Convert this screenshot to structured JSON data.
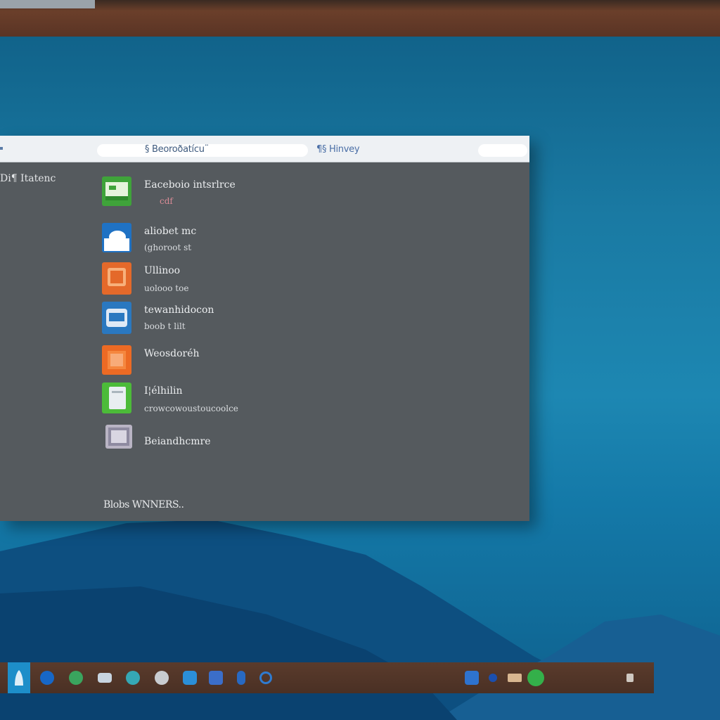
{
  "window": {
    "titlebar_left_text": "§ Beoroðatícu¨",
    "titlebar_right_text": "¶§ Hinvey",
    "sidebar_title": "Di¶ Itatenc",
    "footer_text": "Blobs WNNERS.."
  },
  "apps": [
    {
      "name": "Eaceboio intsrlrce",
      "sub": "cdf",
      "icon": "spreadsheet-icon",
      "color": "#3fa33a"
    },
    {
      "name": "aliobet mc",
      "sub": "(ghoroot st",
      "icon": "cloud-icon",
      "color": "#1f72c4"
    },
    {
      "name": "Ullinoo",
      "sub": "uolooo toe",
      "icon": "folder-icon",
      "color": "#e4692a"
    },
    {
      "name": "tewanhidocon",
      "sub": "boob t lilt",
      "icon": "message-icon",
      "color": "#2a78c0"
    },
    {
      "name": "Weosdoréh",
      "sub": "",
      "icon": "box-icon",
      "color": "#ec6a24"
    },
    {
      "name": "I¦élhilin",
      "sub": "crowcowoustoucoolce",
      "icon": "document-icon",
      "color": "#4cbb39"
    },
    {
      "name": "Beiandhcmre",
      "sub": "",
      "icon": "archive-icon",
      "color": "#b9b4c4"
    }
  ],
  "taskbar": {
    "items": [
      {
        "name": "start-icon",
        "color": "#dfeef7"
      },
      {
        "name": "browser-icon",
        "color": "#1767c7"
      },
      {
        "name": "maps-icon",
        "color": "#3aa55e"
      },
      {
        "name": "mail-icon",
        "color": "#c8d4e0"
      },
      {
        "name": "globe-icon",
        "color": "#35a8b5"
      },
      {
        "name": "settings-icon",
        "color": "#c9ccd0"
      },
      {
        "name": "store-icon",
        "color": "#2b8fd8"
      },
      {
        "name": "shield-icon",
        "color": "#3b6ec9"
      },
      {
        "name": "contacts-icon",
        "color": "#2869c2"
      },
      {
        "name": "search-icon",
        "color": "#2f7bd0"
      }
    ],
    "tray": [
      {
        "name": "network-icon",
        "color": "#2e73cf"
      },
      {
        "name": "bluetooth-icon",
        "color": "#1b4fae"
      },
      {
        "name": "battery-icon",
        "color": "#d8b690"
      },
      {
        "name": "status-green-icon",
        "color": "#34b04a"
      },
      {
        "name": "notification-icon",
        "color": "#cfc8c1"
      }
    ]
  },
  "colors": {
    "window_body": "#555a5e",
    "titlebar": "#eef1f4",
    "taskbar": "#4f3427",
    "accent": "#1d8ec9"
  }
}
